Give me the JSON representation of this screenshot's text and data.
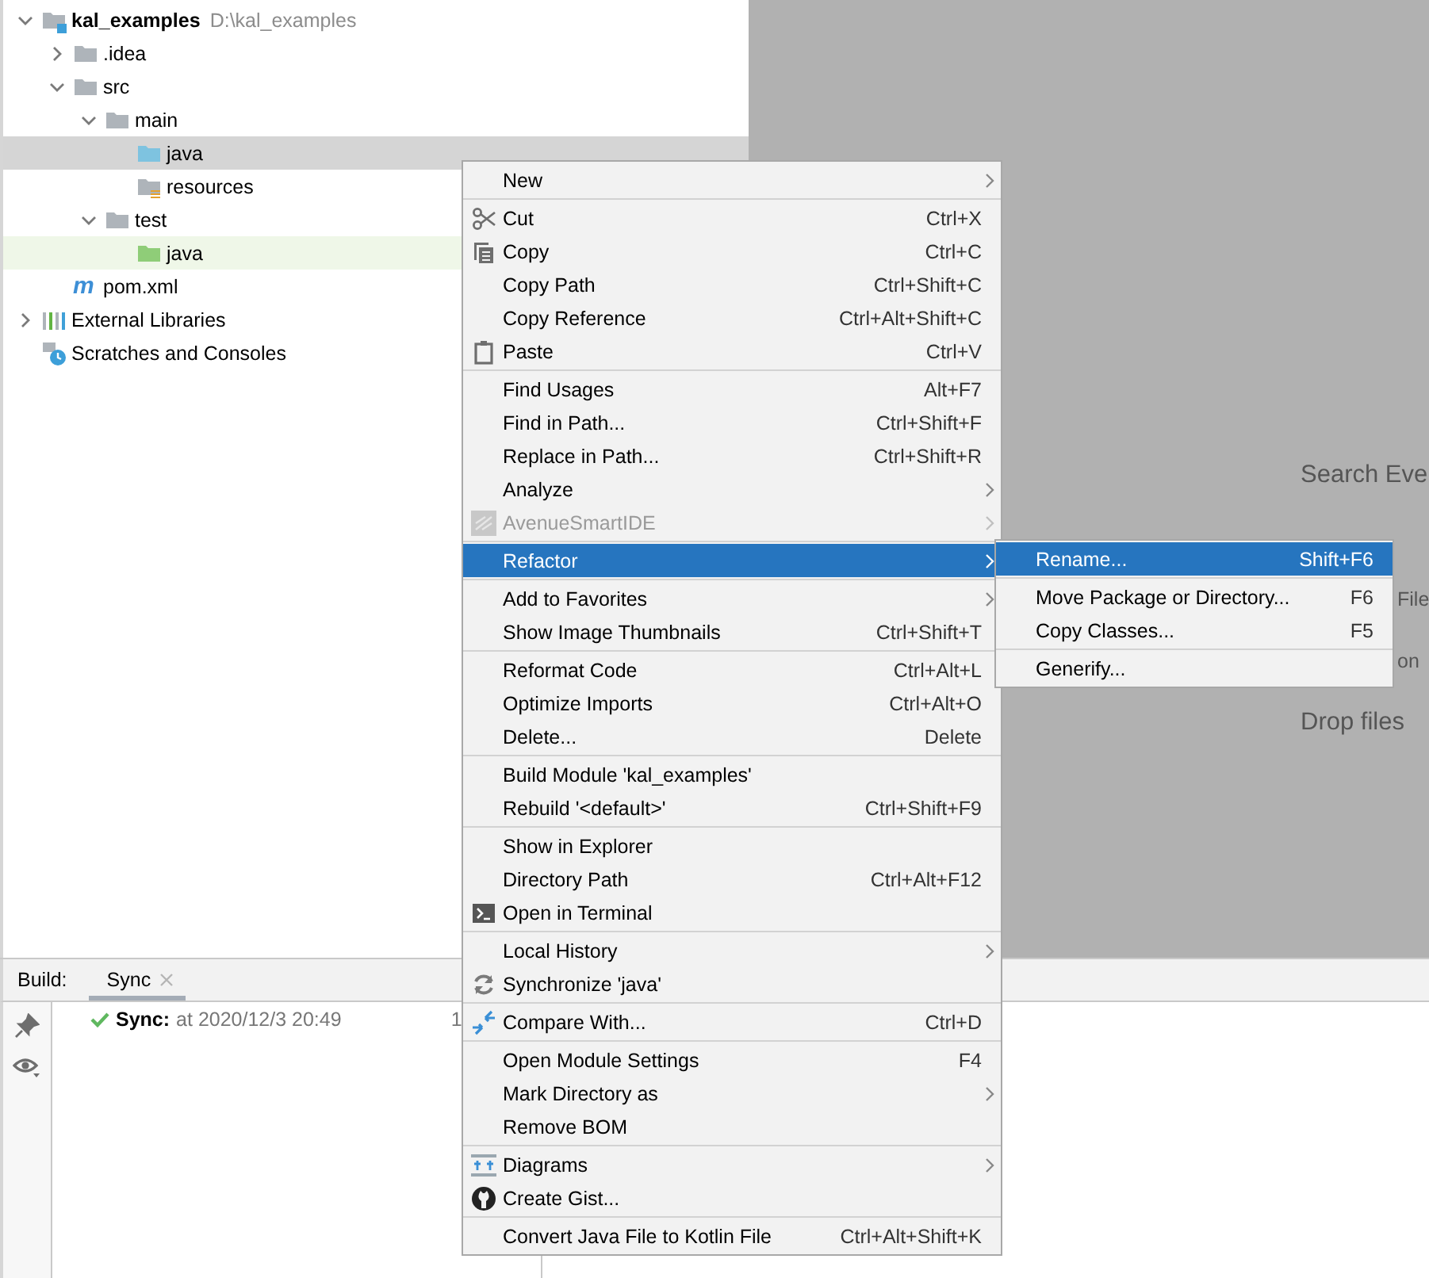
{
  "project_tree": {
    "nodes": [
      {
        "label": "kal_examples",
        "path": "D:\\kal_examples",
        "kind": "module",
        "expanded": true,
        "selected": false,
        "children": [
          {
            "label": ".idea",
            "kind": "folder",
            "expanded": false,
            "selected": false
          },
          {
            "label": "src",
            "kind": "folder",
            "expanded": true,
            "selected": false,
            "children": [
              {
                "label": "main",
                "kind": "folder",
                "expanded": true,
                "selected": false,
                "children": [
                  {
                    "label": "java",
                    "kind": "source",
                    "selected": true
                  },
                  {
                    "label": "resources",
                    "kind": "resources",
                    "selected": false
                  }
                ]
              },
              {
                "label": "test",
                "kind": "folder",
                "expanded": true,
                "selected": false,
                "children": [
                  {
                    "label": "java",
                    "kind": "test",
                    "selected": false
                  }
                ]
              }
            ]
          },
          {
            "label": "pom.xml",
            "kind": "maven",
            "glyph": "m",
            "selected": false
          }
        ]
      },
      {
        "label": "External Libraries",
        "kind": "libraries",
        "expanded": false,
        "selected": false
      },
      {
        "label": "Scratches and Consoles",
        "kind": "scratches",
        "selected": false
      }
    ]
  },
  "editor_hints": [
    {
      "text": "Search Eve",
      "kind": "line"
    },
    {
      "text": "File",
      "kind": "fragment"
    },
    {
      "text": "on",
      "kind": "fragment"
    },
    {
      "text": "Drop files",
      "kind": "line"
    }
  ],
  "build_panel": {
    "label": "Build:",
    "tabs": [
      {
        "label": "Sync",
        "selected": true
      }
    ],
    "result": {
      "title": "Sync:",
      "detail": "at 2020/12/3 20:49",
      "column_2": "1"
    }
  },
  "context_menu": {
    "groups": [
      {
        "items": [
          {
            "label": "New",
            "kind": "plain",
            "has_submenu": true,
            "disabled": false,
            "selected": false
          }
        ]
      },
      {
        "items": [
          {
            "label": "Cut",
            "shortcut": "Ctrl+X",
            "kind": "cut",
            "has_submenu": false,
            "disabled": false,
            "selected": false
          },
          {
            "label": "Copy",
            "shortcut": "Ctrl+C",
            "kind": "copy",
            "has_submenu": false,
            "disabled": false,
            "selected": false
          },
          {
            "label": "Copy Path",
            "shortcut": "Ctrl+Shift+C",
            "kind": "plain",
            "has_submenu": false,
            "disabled": false,
            "selected": false
          },
          {
            "label": "Copy Reference",
            "shortcut": "Ctrl+Alt+Shift+C",
            "kind": "plain",
            "has_submenu": false,
            "disabled": false,
            "selected": false
          },
          {
            "label": "Paste",
            "shortcut": "Ctrl+V",
            "kind": "paste",
            "has_submenu": false,
            "disabled": false,
            "selected": false
          }
        ]
      },
      {
        "items": [
          {
            "label": "Find Usages",
            "shortcut": "Alt+F7",
            "kind": "plain",
            "has_submenu": false,
            "disabled": false,
            "selected": false
          },
          {
            "label": "Find in Path...",
            "shortcut": "Ctrl+Shift+F",
            "kind": "plain",
            "has_submenu": false,
            "disabled": false,
            "selected": false
          },
          {
            "label": "Replace in Path...",
            "shortcut": "Ctrl+Shift+R",
            "kind": "plain",
            "has_submenu": false,
            "disabled": false,
            "selected": false
          },
          {
            "label": "Analyze",
            "kind": "plain",
            "has_submenu": true,
            "disabled": false,
            "selected": false
          },
          {
            "label": "AvenueSmartIDE",
            "kind": "plugin",
            "has_submenu": true,
            "disabled": true,
            "selected": false
          }
        ]
      },
      {
        "items": [
          {
            "label": "Refactor",
            "kind": "plain",
            "has_submenu": true,
            "disabled": false,
            "selected": true
          }
        ]
      },
      {
        "items": [
          {
            "label": "Add to Favorites",
            "kind": "plain",
            "has_submenu": true,
            "disabled": false,
            "selected": false
          },
          {
            "label": "Show Image Thumbnails",
            "shortcut": "Ctrl+Shift+T",
            "kind": "plain",
            "has_submenu": false,
            "disabled": false,
            "selected": false
          }
        ]
      },
      {
        "items": [
          {
            "label": "Reformat Code",
            "shortcut": "Ctrl+Alt+L",
            "kind": "plain",
            "has_submenu": false,
            "disabled": false,
            "selected": false
          },
          {
            "label": "Optimize Imports",
            "shortcut": "Ctrl+Alt+O",
            "kind": "plain",
            "has_submenu": false,
            "disabled": false,
            "selected": false
          },
          {
            "label": "Delete...",
            "shortcut": "Delete",
            "kind": "plain",
            "has_submenu": false,
            "disabled": false,
            "selected": false
          }
        ]
      },
      {
        "items": [
          {
            "label": "Build Module 'kal_examples'",
            "kind": "plain",
            "has_submenu": false,
            "disabled": false,
            "selected": false
          },
          {
            "label": "Rebuild '<default>'",
            "shortcut": "Ctrl+Shift+F9",
            "kind": "plain",
            "has_submenu": false,
            "disabled": false,
            "selected": false
          }
        ]
      },
      {
        "items": [
          {
            "label": "Show in Explorer",
            "kind": "plain",
            "has_submenu": false,
            "disabled": false,
            "selected": false
          },
          {
            "label": "Directory Path",
            "shortcut": "Ctrl+Alt+F12",
            "kind": "plain",
            "has_submenu": false,
            "disabled": false,
            "selected": false
          },
          {
            "label": "Open in Terminal",
            "kind": "terminal",
            "has_submenu": false,
            "disabled": false,
            "selected": false
          }
        ]
      },
      {
        "items": [
          {
            "label": "Local History",
            "kind": "plain",
            "has_submenu": true,
            "disabled": false,
            "selected": false
          },
          {
            "label": "Synchronize 'java'",
            "kind": "sync",
            "has_submenu": false,
            "disabled": false,
            "selected": false
          }
        ]
      },
      {
        "items": [
          {
            "label": "Compare With...",
            "shortcut": "Ctrl+D",
            "kind": "compare",
            "has_submenu": false,
            "disabled": false,
            "selected": false
          }
        ]
      },
      {
        "items": [
          {
            "label": "Open Module Settings",
            "shortcut": "F4",
            "kind": "plain",
            "has_submenu": false,
            "disabled": false,
            "selected": false
          },
          {
            "label": "Mark Directory as",
            "kind": "plain",
            "has_submenu": true,
            "disabled": false,
            "selected": false
          },
          {
            "label": "Remove BOM",
            "kind": "plain",
            "has_submenu": false,
            "disabled": false,
            "selected": false
          }
        ]
      },
      {
        "items": [
          {
            "label": "Diagrams",
            "kind": "diagram",
            "has_submenu": true,
            "disabled": false,
            "selected": false
          },
          {
            "label": "Create Gist...",
            "kind": "gist",
            "has_submenu": false,
            "disabled": false,
            "selected": false
          }
        ]
      },
      {
        "items": [
          {
            "label": "Convert Java File to Kotlin File",
            "shortcut": "Ctrl+Alt+Shift+K",
            "kind": "plain",
            "has_submenu": false,
            "disabled": false,
            "selected": false
          }
        ]
      }
    ]
  },
  "refactor_submenu": {
    "groups": [
      {
        "items": [
          {
            "label": "Rename...",
            "shortcut": "Shift+F6",
            "selected": true
          }
        ]
      },
      {
        "items": [
          {
            "label": "Move Package or Directory...",
            "shortcut": "F6",
            "selected": false
          },
          {
            "label": "Copy Classes...",
            "shortcut": "F5",
            "selected": false
          }
        ]
      },
      {
        "items": [
          {
            "label": "Generify...",
            "selected": false
          }
        ]
      }
    ]
  }
}
